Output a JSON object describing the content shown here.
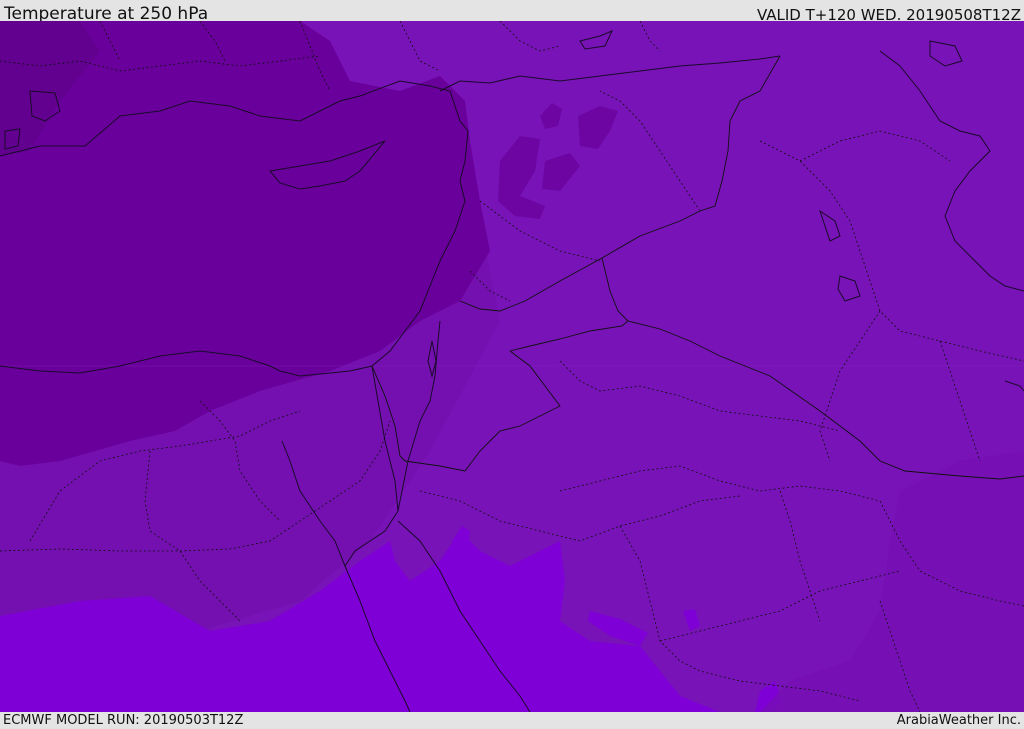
{
  "header": {
    "title": "Temperature at 250 hPa",
    "valid_time": "VALID T+120 WED. 20190508T12Z"
  },
  "footer": {
    "model_run": "ECMWF MODEL RUN: 20190503T12Z",
    "credit": "ArabiaWeather Inc."
  },
  "map": {
    "colors": {
      "coldest": "#650095",
      "cold": "#6d05a2",
      "mid": "#7812b6",
      "main": "#7a13b8",
      "warm": "#7f00d7",
      "coast_line": "#1a0a2a",
      "border_line": "#111111"
    }
  }
}
